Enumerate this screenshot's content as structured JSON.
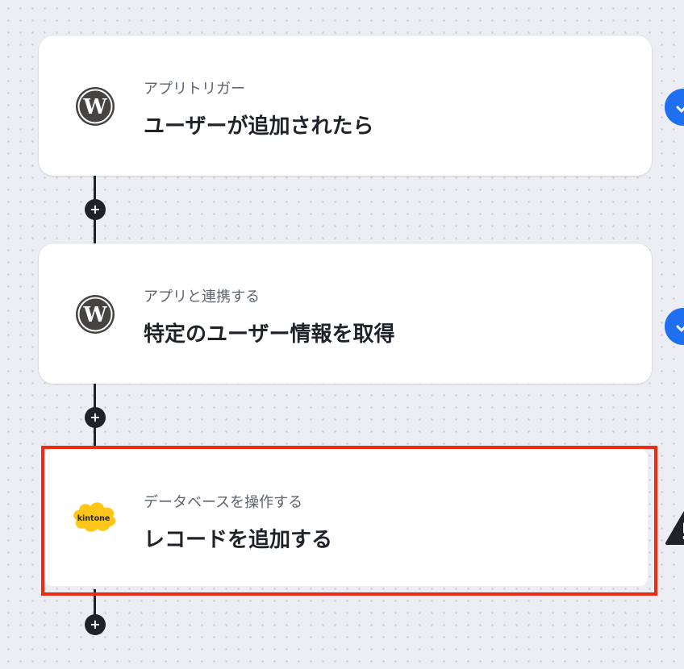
{
  "flow": {
    "steps": [
      {
        "app_icon": "wordpress-logo",
        "subtitle": "アプリトリガー",
        "title": "ユーザーが追加されたら",
        "status": "complete"
      },
      {
        "app_icon": "wordpress-logo",
        "subtitle": "アプリと連携する",
        "title": "特定のユーザー情報を取得",
        "status": "complete"
      },
      {
        "app_icon": "kintone-logo",
        "app_logo_text": "kintone",
        "subtitle": "データベースを操作する",
        "title": "レコードを追加する",
        "status": "warning",
        "selected": true
      }
    ],
    "add_step_symbol": "+"
  },
  "colors": {
    "canvas_background": "#eceef4",
    "connector": "#1f2329",
    "selection_outline": "#ee2a12",
    "status_complete": "#1f6ff0",
    "status_warning": "#1f2329",
    "kintone_yellow": "#ffc61a"
  }
}
